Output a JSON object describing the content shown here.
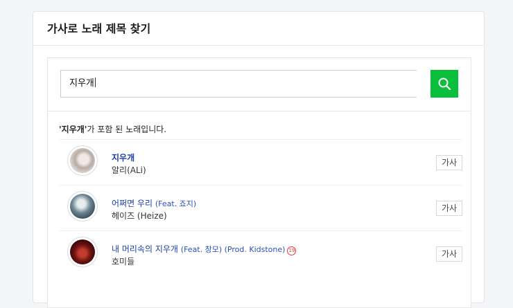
{
  "panel": {
    "title": "가사로 노래 제목 찾기"
  },
  "search": {
    "value": "지우개"
  },
  "result_note": {
    "keyword_quoted": "'지우개'",
    "suffix": "가 포함 된 노래입니다."
  },
  "songs": [
    {
      "title": "지우개",
      "feat": "",
      "artist": "알리(ALi)",
      "lyrics_label": "가사",
      "age_badge": ""
    },
    {
      "title": "어쩌면 우리",
      "feat": "(Feat. 죠지)",
      "artist": "헤이즈 (Heize)",
      "lyrics_label": "가사",
      "age_badge": ""
    },
    {
      "title": "내 머리속의 지우개",
      "feat": "(Feat. 창모) (Prod. Kidstone)",
      "artist": "호미들",
      "lyrics_label": "가사",
      "age_badge": "19"
    }
  ],
  "colors": {
    "search_button": "#0abf3b",
    "title_link": "#1a3faa"
  },
  "icons": {
    "search": "search-icon"
  }
}
